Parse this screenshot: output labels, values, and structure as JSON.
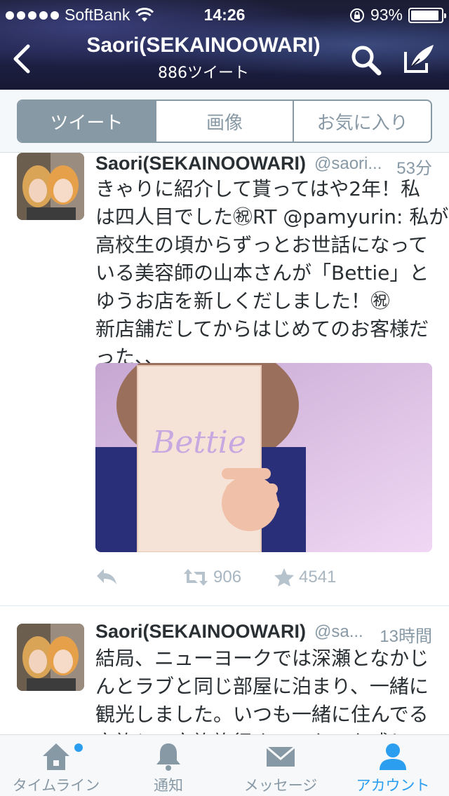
{
  "status_bar": {
    "carrier": "SoftBank",
    "time": "14:26",
    "battery": "93%",
    "battery_level": 0.93
  },
  "nav": {
    "title": "Saori(SEKAINOOWARI)",
    "subtitle": "886ツイート"
  },
  "segments": [
    {
      "label": "ツイート",
      "active": true
    },
    {
      "label": "画像",
      "active": false
    },
    {
      "label": "お気に入り",
      "active": false
    }
  ],
  "tweets": [
    {
      "author": "Saori(SEKAINOOWARI)",
      "handle": "@saori...",
      "time": "53分",
      "lines": [
        "きゃりに紹介して貰ってはや2年！私",
        "は四人目でした㊗RT @pamyurin: 私が",
        "高校生の頃からずっとお世話になって",
        "いる美容師の山本さんが「Bettie」と",
        "ゆうお店を新しくだしました！㊗",
        "新店舗だしてからはじめてのお客様だ",
        "った、、"
      ],
      "media_text": "Bettie",
      "retweets": "906",
      "favorites": "4541"
    },
    {
      "author": "Saori(SEKAINOOWARI)",
      "handle": "@sa...",
      "time": "13時間",
      "lines": [
        "結局、ニューヨークでは深瀬となかじ",
        "んとラブと同じ部屋に泊まり、一緒に",
        "観光しました。いつも一緒に住んでる",
        "家族と、家族旅行するみたいな感じの"
      ]
    }
  ],
  "tabbar": [
    {
      "label": "タイムライン",
      "icon": "home-icon",
      "active": false,
      "badge": true
    },
    {
      "label": "通知",
      "icon": "bell-icon",
      "active": false
    },
    {
      "label": "メッセージ",
      "icon": "envelope-icon",
      "active": false
    },
    {
      "label": "アカウント",
      "icon": "person-icon",
      "active": true
    }
  ],
  "colors": {
    "accent": "#2b9ef0",
    "muted": "#8899a6",
    "text": "#292f33"
  }
}
